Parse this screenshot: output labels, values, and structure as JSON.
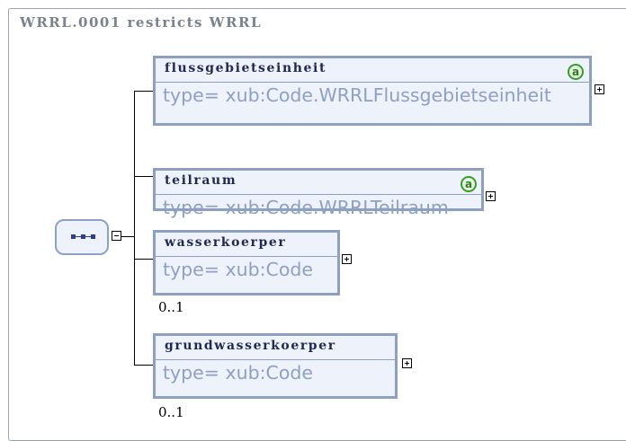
{
  "frame": {
    "title": "WRRL.0001 restricts WRRL"
  },
  "sequence": {
    "icon": "sequence-compositor-icon",
    "collapse": "minus"
  },
  "elements": [
    {
      "name": "flussgebietseinheit",
      "type": "type= xub:Code.WRRLFlussgebietseinheit",
      "has_attribute": true,
      "attribute_icon": "a",
      "occurs": ""
    },
    {
      "name": "teilraum",
      "type": "type= xub:Code.WRRLTeilraum",
      "has_attribute": true,
      "attribute_icon": "a",
      "occurs": ""
    },
    {
      "name": "wasserkoerper",
      "type": "type= xub:Code",
      "has_attribute": false,
      "occurs": "0..1"
    },
    {
      "name": "grundwasserkoerper",
      "type": "type= xub:Code",
      "has_attribute": false,
      "occurs": "0..1"
    }
  ],
  "colors": {
    "element_border": "#8ea0bf",
    "element_fill": "#eef2fa",
    "attribute_badge": "#3a9b2e"
  }
}
